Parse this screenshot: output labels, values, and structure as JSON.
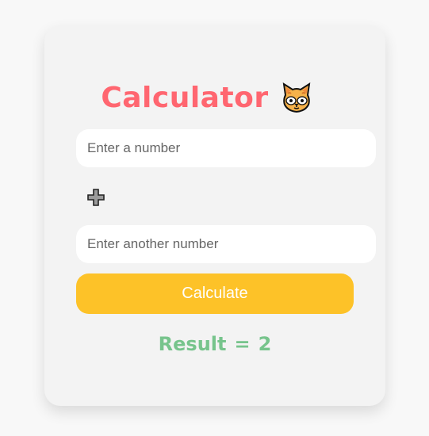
{
  "app": {
    "title": "Calculator",
    "title_icon": "cat-face-icon"
  },
  "inputs": {
    "first_placeholder": "Enter a number",
    "second_placeholder": "Enter another number"
  },
  "operation": {
    "symbol": "+",
    "icon": "plus-icon"
  },
  "actions": {
    "calculate_label": "Calculate"
  },
  "result": {
    "label": "Result",
    "separator": "=",
    "value": "2"
  },
  "colors": {
    "title": "#ff6670",
    "button": "#fdc228",
    "result": "#77c48c",
    "background": "#f8f8f8",
    "card": "#f3f3f3"
  }
}
